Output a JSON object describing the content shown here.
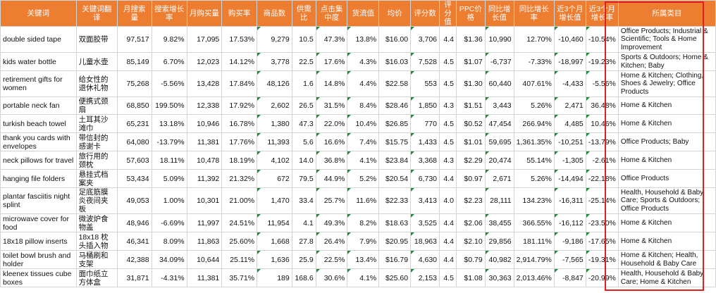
{
  "sheet": {
    "headers": [
      "关键词",
      "关键词翻译",
      "月搜索量",
      "搜索增长率",
      "月购买量",
      "购买率",
      "商品数",
      "供需比",
      "点击集中度",
      "货流值",
      "均价",
      "评分数",
      "评分值",
      "PPC价格",
      "同比增长值",
      "同比增长率",
      "近3个月增长值",
      "近3个月增长率",
      "所属类目"
    ],
    "rows": [
      {
        "keyword": "double sided tape",
        "translation": "双面胶带",
        "search_volume": "97,517",
        "search_growth": "9.82%",
        "purchases": "17,095",
        "purchase_rate": "17.53%",
        "products": "9,279",
        "supply_ratio": "10.5",
        "click_conc": "47.3%",
        "flow": "13.8%",
        "avg_price": "$16.00",
        "ratings": "3,706",
        "rating": "4.4",
        "ppc": "$1.36",
        "yoy_value": "10,990",
        "yoy_rate": "12.70%",
        "m3_value": "-10,460",
        "m3_rate": "-10.54%",
        "category": "Office Products; Industrial & Scientific; Tools & Home Improvement"
      },
      {
        "keyword": "kids water bottle",
        "translation": "儿童水壶",
        "search_volume": "85,149",
        "search_growth": "6.70%",
        "purchases": "12,023",
        "purchase_rate": "14.12%",
        "products": "3,778",
        "supply_ratio": "22.5",
        "click_conc": "17.6%",
        "flow": "4.3%",
        "avg_price": "$16.03",
        "ratings": "7,528",
        "rating": "4.5",
        "ppc": "$1.07",
        "yoy_value": "-6,737",
        "yoy_rate": "-7.33%",
        "m3_value": "-18,997",
        "m3_rate": "-19.23%",
        "category": "Sports & Outdoors; Home & Kitchen; Baby"
      },
      {
        "keyword": "retirement gifts for women",
        "translation": "给女性的退休礼物",
        "search_volume": "75,268",
        "search_growth": "-5.56%",
        "purchases": "13,428",
        "purchase_rate": "17.84%",
        "products": "48,126",
        "supply_ratio": "1.6",
        "click_conc": "14.8%",
        "flow": "4.4%",
        "avg_price": "$22.58",
        "ratings": "553",
        "rating": "4.5",
        "ppc": "$1.30",
        "yoy_value": "60,440",
        "yoy_rate": "407.61%",
        "m3_value": "-4,433",
        "m3_rate": "-5.56%",
        "category": "Home & Kitchen; Clothing, Shoes & Jewelry; Office Products"
      },
      {
        "keyword": "portable neck fan",
        "translation": "便携式颈扇",
        "search_volume": "68,850",
        "search_growth": "199.50%",
        "purchases": "12,338",
        "purchase_rate": "17.92%",
        "products": "2,602",
        "supply_ratio": "26.5",
        "click_conc": "31.5%",
        "flow": "8.4%",
        "avg_price": "$28.46",
        "ratings": "1,850",
        "rating": "4.3",
        "ppc": "$1.51",
        "yoy_value": "3,443",
        "yoy_rate": "5.26%",
        "m3_value": "2,471",
        "m3_rate": "36.48%",
        "category": "Home & Kitchen"
      },
      {
        "keyword": "turkish beach towel",
        "translation": "土耳其沙滩巾",
        "search_volume": "65,231",
        "search_growth": "13.18%",
        "purchases": "10,946",
        "purchase_rate": "16.78%",
        "products": "1,380",
        "supply_ratio": "47.3",
        "click_conc": "22.0%",
        "flow": "10.4%",
        "avg_price": "$26.85",
        "ratings": "770",
        "rating": "4.5",
        "ppc": "$0.52",
        "yoy_value": "47,454",
        "yoy_rate": "266.94%",
        "m3_value": "4,485",
        "m3_rate": "10.46%",
        "category": "Home & Kitchen"
      },
      {
        "keyword": "thank you cards with envelopes",
        "translation": "带信封的感谢卡",
        "search_volume": "64,080",
        "search_growth": "-13.79%",
        "purchases": "11,381",
        "purchase_rate": "17.76%",
        "products": "11,393",
        "supply_ratio": "5.6",
        "click_conc": "16.6%",
        "flow": "7.4%",
        "avg_price": "$15.75",
        "ratings": "1,433",
        "rating": "4.5",
        "ppc": "$1.01",
        "yoy_value": "59,695",
        "yoy_rate": "1,361.35%",
        "m3_value": "-10,251",
        "m3_rate": "-13.79%",
        "category": "Office Products; Baby"
      },
      {
        "keyword": "neck pillows for travel",
        "translation": "旅行用的颈枕",
        "search_volume": "57,603",
        "search_growth": "18.11%",
        "purchases": "10,478",
        "purchase_rate": "18.19%",
        "products": "4,102",
        "supply_ratio": "14.0",
        "click_conc": "36.8%",
        "flow": "4.1%",
        "avg_price": "$23.84",
        "ratings": "3,368",
        "rating": "4.3",
        "ppc": "$2.29",
        "yoy_value": "20,474",
        "yoy_rate": "55.14%",
        "m3_value": "-1,305",
        "m3_rate": "-2.61%",
        "category": "Home & Kitchen"
      },
      {
        "keyword": "hanging file folders",
        "translation": "悬挂式档案夹",
        "search_volume": "53,434",
        "search_growth": "5.09%",
        "purchases": "11,392",
        "purchase_rate": "21.32%",
        "products": "672",
        "supply_ratio": "79.5",
        "click_conc": "44.9%",
        "flow": "5.2%",
        "avg_price": "$20.54",
        "ratings": "6,730",
        "rating": "4.4",
        "ppc": "$0.97",
        "yoy_value": "2,671",
        "yoy_rate": "5.26%",
        "m3_value": "-14,494",
        "m3_rate": "-22.18%",
        "category": "Office Products"
      },
      {
        "keyword": "plantar fasciitis night splint",
        "translation": "足底筋膜炎夜间夹板",
        "search_volume": "49,053",
        "search_growth": "1.00%",
        "purchases": "10,301",
        "purchase_rate": "21.00%",
        "products": "1,470",
        "supply_ratio": "33.4",
        "click_conc": "25.7%",
        "flow": "11.6%",
        "avg_price": "$22.33",
        "ratings": "3,413",
        "rating": "4.0",
        "ppc": "$2.23",
        "yoy_value": "28,111",
        "yoy_rate": "134.23%",
        "m3_value": "-16,311",
        "m3_rate": "-25.14%",
        "category": "Health, Household & Baby Care; Sports & Outdoors; Office Products"
      },
      {
        "keyword": "microwave cover for food",
        "translation": "微波炉食物盖",
        "search_volume": "48,946",
        "search_growth": "-6.69%",
        "purchases": "11,997",
        "purchase_rate": "24.51%",
        "products": "11,954",
        "supply_ratio": "4.1",
        "click_conc": "49.3%",
        "flow": "8.2%",
        "avg_price": "$18.63",
        "ratings": "3,525",
        "rating": "4.4",
        "ppc": "$2.06",
        "yoy_value": "38,455",
        "yoy_rate": "366.55%",
        "m3_value": "-16,112",
        "m3_rate": "-23.50%",
        "category": "Home & Kitchen"
      },
      {
        "keyword": "18x18 pillow inserts",
        "translation": "18x18 枕头插入物",
        "search_volume": "46,341",
        "search_growth": "8.09%",
        "purchases": "11,863",
        "purchase_rate": "25.60%",
        "products": "1,668",
        "supply_ratio": "27.8",
        "click_conc": "26.4%",
        "flow": "7.9%",
        "avg_price": "$20.95",
        "ratings": "18,963",
        "rating": "4.4",
        "ppc": "$2.10",
        "yoy_value": "29,856",
        "yoy_rate": "181.11%",
        "m3_value": "-9,186",
        "m3_rate": "-17.65%",
        "category": "Home & Kitchen"
      },
      {
        "keyword": "toilet bowl brush and holder",
        "translation": "马桶刷和支架",
        "search_volume": "42,388",
        "search_growth": "34.09%",
        "purchases": "10,644",
        "purchase_rate": "25.11%",
        "products": "1,636",
        "supply_ratio": "25.9",
        "click_conc": "22.5%",
        "flow": "13.4%",
        "avg_price": "$16.79",
        "ratings": "4,630",
        "rating": "4.4",
        "ppc": "$0.79",
        "yoy_value": "40,982",
        "yoy_rate": "2,914.79%",
        "m3_value": "-7,565",
        "m3_rate": "-19.31%",
        "category": "Home & Kitchen; Health, Household & Baby Care"
      },
      {
        "keyword": "kleenex tissues cube boxes",
        "translation": "面巾纸立方体盒",
        "search_volume": "31,871",
        "search_growth": "-4.31%",
        "purchases": "11,381",
        "purchase_rate": "35.71%",
        "products": "189",
        "supply_ratio": "168.6",
        "click_conc": "30.6%",
        "flow": "4.1%",
        "avg_price": "$25.60",
        "ratings": "2,153",
        "rating": "4.5",
        "ppc": "$1.08",
        "yoy_value": "30,363",
        "yoy_rate": "2,013.46%",
        "m3_value": "-8,847",
        "m3_rate": "-20.99%",
        "category": "Health, Household & Baby Care; Home & Kitchen"
      }
    ]
  }
}
